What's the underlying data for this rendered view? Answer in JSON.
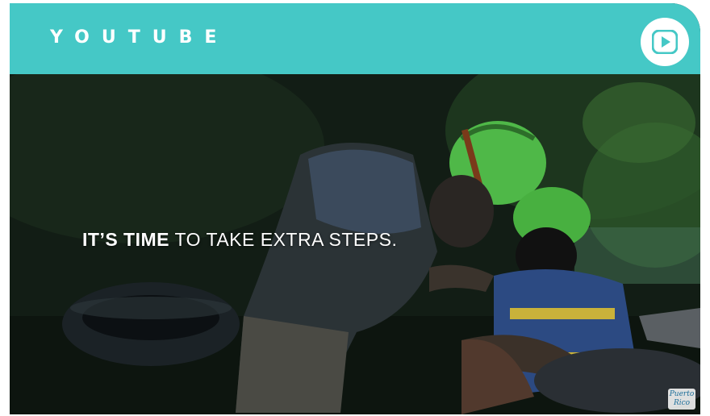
{
  "header": {
    "title": "YOUTUBE"
  },
  "video": {
    "caption_bold": "IT’S TIME",
    "caption_rest": " TO TAKE EXTRA STEPS.",
    "logo_text": "Puerto Rico"
  },
  "colors": {
    "header_bg": "#45c8c6",
    "header_text": "#ffffff",
    "play_icon": "#45c8c6"
  },
  "icons": {
    "play": "youtube-play-icon"
  }
}
